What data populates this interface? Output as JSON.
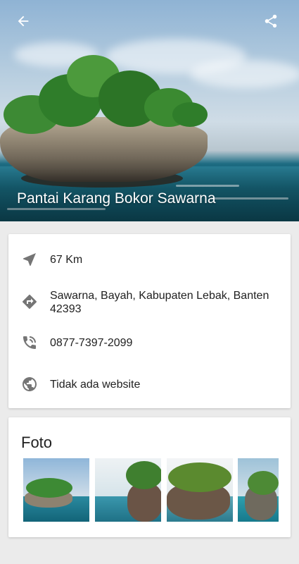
{
  "hero": {
    "title": "Pantai Karang Bokor Sawarna",
    "back_icon": "arrow-left-icon",
    "share_icon": "share-icon"
  },
  "info": {
    "distance": "67 Km",
    "address": "Sawarna, Bayah, Kabupaten Lebak, Banten 42393",
    "phone": "0877-7397-2099",
    "website": "Tidak ada website",
    "icons": [
      "navigation-icon",
      "directions-icon",
      "phone-icon",
      "globe-icon"
    ]
  },
  "photos": {
    "title": "Foto",
    "items": [
      "photo-1",
      "photo-2",
      "photo-3",
      "photo-4"
    ]
  },
  "colors": {
    "icon_gray": "#757575",
    "background": "#ebebeb"
  }
}
